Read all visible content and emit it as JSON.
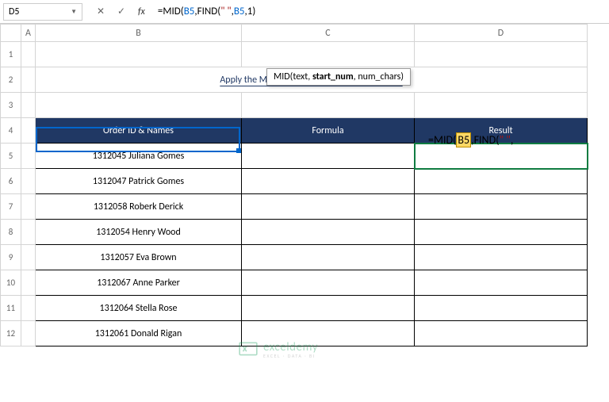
{
  "nameBox": "D5",
  "formulaBar": {
    "prefix": "=",
    "fn1": "MID",
    "open1": "(",
    "ref1": "B5",
    "comma1": ",",
    "fn2": "FIND",
    "open2": "(",
    "str": "\" \"",
    "comma2": ",",
    "ref2": "B5",
    "comma3": ",",
    "num": "1",
    "close": ")"
  },
  "tooltip": {
    "fn": "MID(",
    "arg1": "text",
    "sep1": ", ",
    "arg2": "start_num",
    "sep2": ", ",
    "arg3": "num_chars",
    "close": ")"
  },
  "colHeaders": {
    "a": "A",
    "b": "B",
    "c": "C",
    "d": "D"
  },
  "rowHeaders": [
    "1",
    "2",
    "3",
    "4",
    "5",
    "6",
    "7",
    "8",
    "9",
    "10",
    "11",
    "12"
  ],
  "title": "Apply the MID Function with the FIND Function",
  "headers": {
    "b": "Order ID & Names",
    "c": "Formula",
    "d": "Result"
  },
  "rows": [
    "1312045 Juliana Gomes",
    "1312047 Patrick Gomes",
    "1312058 Roberk Derick",
    "1312054 Henry Wood",
    "1312057 Eva Brown",
    "1312067 Anne Parker",
    "1312064 Stella Rose",
    "1312061 Donald Rigan"
  ],
  "cellFormula": {
    "prefix": "=",
    "fn1": "MID",
    "open1": "(",
    "ref1": "B5",
    "comma1": ",",
    "fn2": "FIND",
    "open2": "(",
    "str": "\" \"",
    "comma2": ","
  },
  "watermark": {
    "brand": "exceldemy",
    "sub": "EXCEL · DATA · BI"
  },
  "chart_data": {
    "type": "table",
    "title": "Apply the MID Function with the FIND Function",
    "columns": [
      "Order ID & Names",
      "Formula",
      "Result"
    ],
    "rows": [
      [
        "1312045 Juliana Gomes",
        "",
        "=MID(B5,FIND(\" \","
      ],
      [
        "1312047 Patrick Gomes",
        "",
        ""
      ],
      [
        "1312058 Roberk Derick",
        "",
        ""
      ],
      [
        "1312054 Henry Wood",
        "",
        ""
      ],
      [
        "1312057 Eva Brown",
        "",
        ""
      ],
      [
        "1312067 Anne Parker",
        "",
        ""
      ],
      [
        "1312064 Stella Rose",
        "",
        ""
      ],
      [
        "1312061 Donald Rigan",
        "",
        ""
      ]
    ]
  }
}
